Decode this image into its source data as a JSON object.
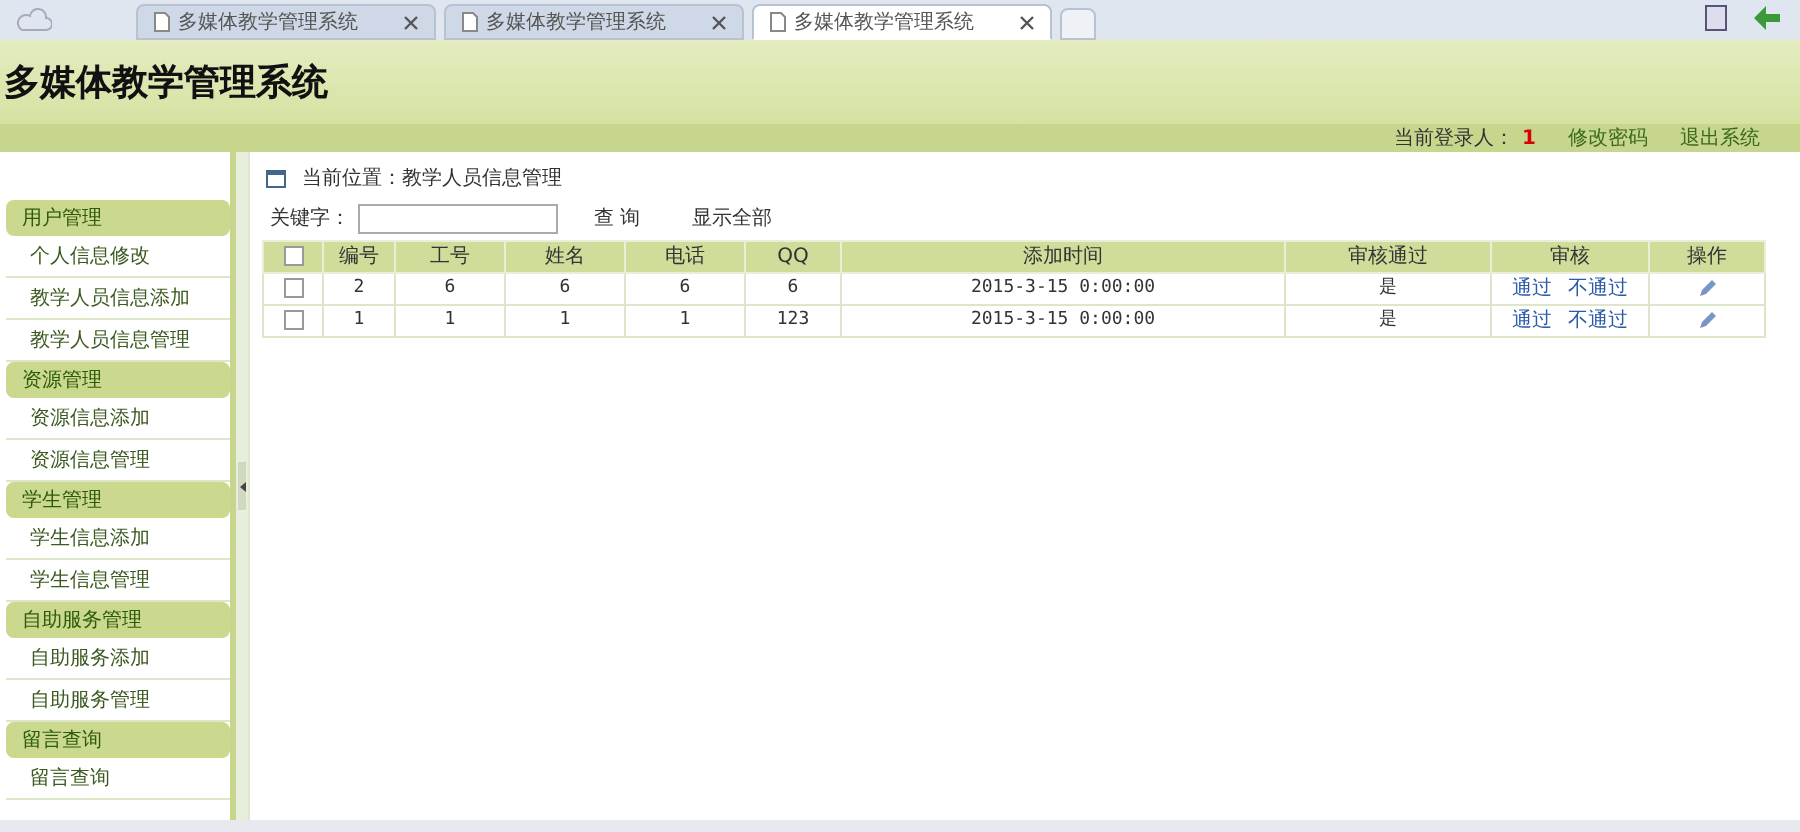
{
  "browser_tabs": [
    {
      "title": "多媒体教学管理系统",
      "selected": false
    },
    {
      "title": "多媒体教学管理系统",
      "selected": false
    },
    {
      "title": "多媒体教学管理系统",
      "selected": true
    }
  ],
  "header": {
    "title": "多媒体教学管理系统"
  },
  "top_bar": {
    "login_label": "当前登录人：",
    "user": "1",
    "links": [
      "修改密码",
      "退出系统"
    ]
  },
  "sidebar": {
    "groups": [
      {
        "title": "用户管理",
        "items": [
          "个人信息修改",
          "教学人员信息添加",
          "教学人员信息管理"
        ]
      },
      {
        "title": "资源管理",
        "items": [
          "资源信息添加",
          "资源信息管理"
        ]
      },
      {
        "title": "学生管理",
        "items": [
          "学生信息添加",
          "学生信息管理"
        ]
      },
      {
        "title": "自助服务管理",
        "items": [
          "自助服务添加",
          "自助服务管理"
        ]
      },
      {
        "title": "留言查询",
        "items": [
          "留言查询"
        ]
      }
    ]
  },
  "breadcrumb": "当前位置：教学人员信息管理",
  "search": {
    "label": "关键字：",
    "buttons": [
      "查 询",
      "显示全部"
    ]
  },
  "table": {
    "header_checked": false,
    "columns": [
      "编号",
      "工号",
      "姓名",
      "电话",
      "QQ",
      "添加时间",
      "审核通过",
      "审核",
      "操作"
    ],
    "rows": [
      {
        "checked": false,
        "cells": [
          "2",
          "6",
          "6",
          "6",
          "6",
          "2015-3-15 0:00:00",
          "是"
        ],
        "actions": [
          "通过",
          "不通过"
        ]
      },
      {
        "checked": false,
        "cells": [
          "1",
          "1",
          "1",
          "1",
          "123",
          "2015-3-15 0:00:00",
          "是"
        ],
        "actions": [
          "通过",
          "不通过"
        ]
      }
    ]
  }
}
